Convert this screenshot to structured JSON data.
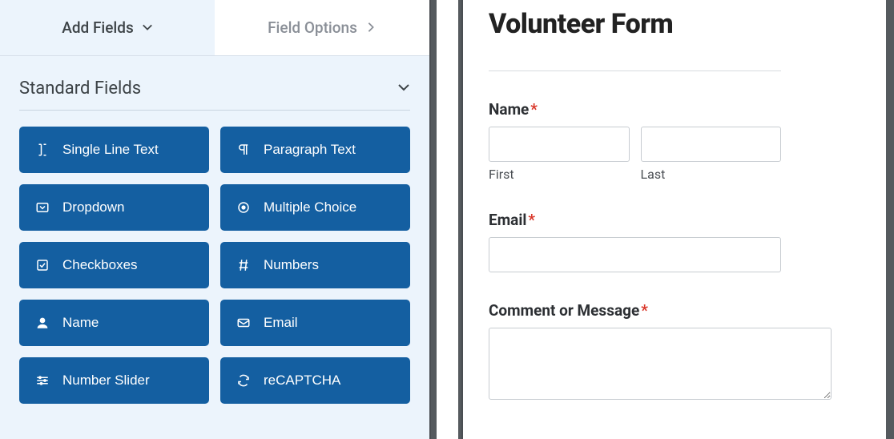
{
  "tabs": {
    "add_fields": "Add Fields",
    "field_options": "Field Options"
  },
  "section": {
    "title": "Standard Fields"
  },
  "fields": {
    "single_line_text": "Single Line Text",
    "paragraph_text": "Paragraph Text",
    "dropdown": "Dropdown",
    "multiple_choice": "Multiple Choice",
    "checkboxes": "Checkboxes",
    "numbers": "Numbers",
    "name": "Name",
    "email": "Email",
    "number_slider": "Number Slider",
    "recaptcha": "reCAPTCHA"
  },
  "form": {
    "title": "Volunteer Form",
    "name_label": "Name",
    "first_label": "First",
    "last_label": "Last",
    "email_label": "Email",
    "comment_label": "Comment or Message",
    "required": "*"
  }
}
